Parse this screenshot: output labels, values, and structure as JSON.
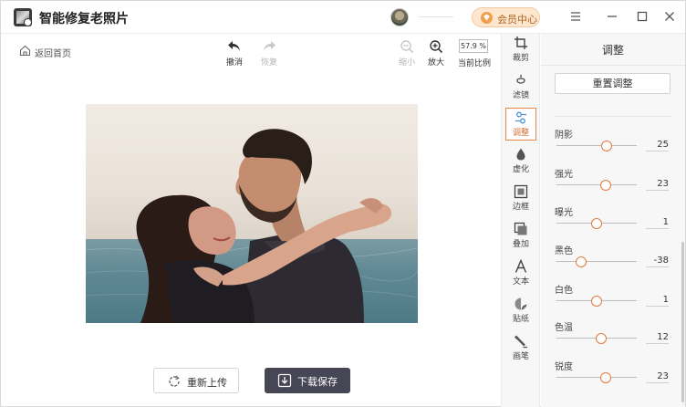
{
  "app": {
    "title": "智能修复老照片"
  },
  "header": {
    "vip_label": "会员中心"
  },
  "toolbar": {
    "back_label": "返回首页",
    "undo_label": "撤消",
    "redo_label": "恢复",
    "zoom_out_label": "缩小",
    "zoom_in_label": "放大",
    "zoom_value": "57.9 %",
    "current_ratio_label": "当前比例"
  },
  "actions": {
    "reupload_label": "重新上传",
    "download_label": "下载保存"
  },
  "toolstrip": {
    "items": [
      {
        "label": "裁剪",
        "icon": "crop-icon"
      },
      {
        "label": "滤镜",
        "icon": "filter-icon"
      },
      {
        "label": "调整",
        "icon": "adjust-icon",
        "active": true
      },
      {
        "label": "虚化",
        "icon": "blur-icon"
      },
      {
        "label": "边框",
        "icon": "border-icon"
      },
      {
        "label": "叠加",
        "icon": "overlay-icon"
      },
      {
        "label": "文本",
        "icon": "text-icon"
      },
      {
        "label": "贴纸",
        "icon": "sticker-icon"
      },
      {
        "label": "画笔",
        "icon": "brush-icon"
      }
    ]
  },
  "panel": {
    "title": "调整",
    "reset_label": "重置调整",
    "sliders": [
      {
        "label": "阴影",
        "value": "25",
        "level": 0.62
      },
      {
        "label": "强光",
        "value": "23",
        "level": 0.61
      },
      {
        "label": "曝光",
        "value": "1",
        "level": 0.505
      },
      {
        "label": "黑色",
        "value": "-38",
        "level": 0.31
      },
      {
        "label": "白色",
        "value": "1",
        "level": 0.505
      },
      {
        "label": "色温",
        "value": "12",
        "level": 0.56
      },
      {
        "label": "锐度",
        "value": "23",
        "level": 0.61
      }
    ]
  },
  "colors": {
    "accent": "#e07a3c",
    "download_bg": "#464655",
    "vip_bg": "#fde7cf",
    "vip_text": "#b2621f"
  }
}
